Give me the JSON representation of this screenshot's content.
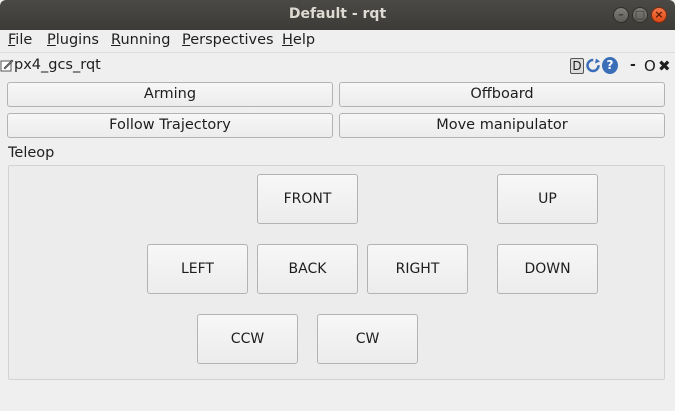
{
  "window": {
    "title": "Default - rqt"
  },
  "menubar": {
    "items": [
      {
        "mnemonic": "F",
        "rest": "ile"
      },
      {
        "mnemonic": "P",
        "rest": "lugins"
      },
      {
        "mnemonic": "R",
        "rest": "unning"
      },
      {
        "mnemonic": "P",
        "rest": "erspectives"
      },
      {
        "mnemonic": "H",
        "rest": "elp"
      }
    ]
  },
  "plugin": {
    "title": "px4_gcs_rqt",
    "controls": {
      "d": "D",
      "help": "?",
      "min": "-",
      "float": "O",
      "close": "✖"
    }
  },
  "buttons": {
    "arming": "Arming",
    "offboard": "Offboard",
    "follow_trajectory": "Follow Trajectory",
    "move_manipulator": "Move manipulator"
  },
  "teleop": {
    "label": "Teleop",
    "front": "FRONT",
    "up": "UP",
    "left": "LEFT",
    "back": "BACK",
    "right": "RIGHT",
    "down": "DOWN",
    "ccw": "CCW",
    "cw": "CW"
  }
}
